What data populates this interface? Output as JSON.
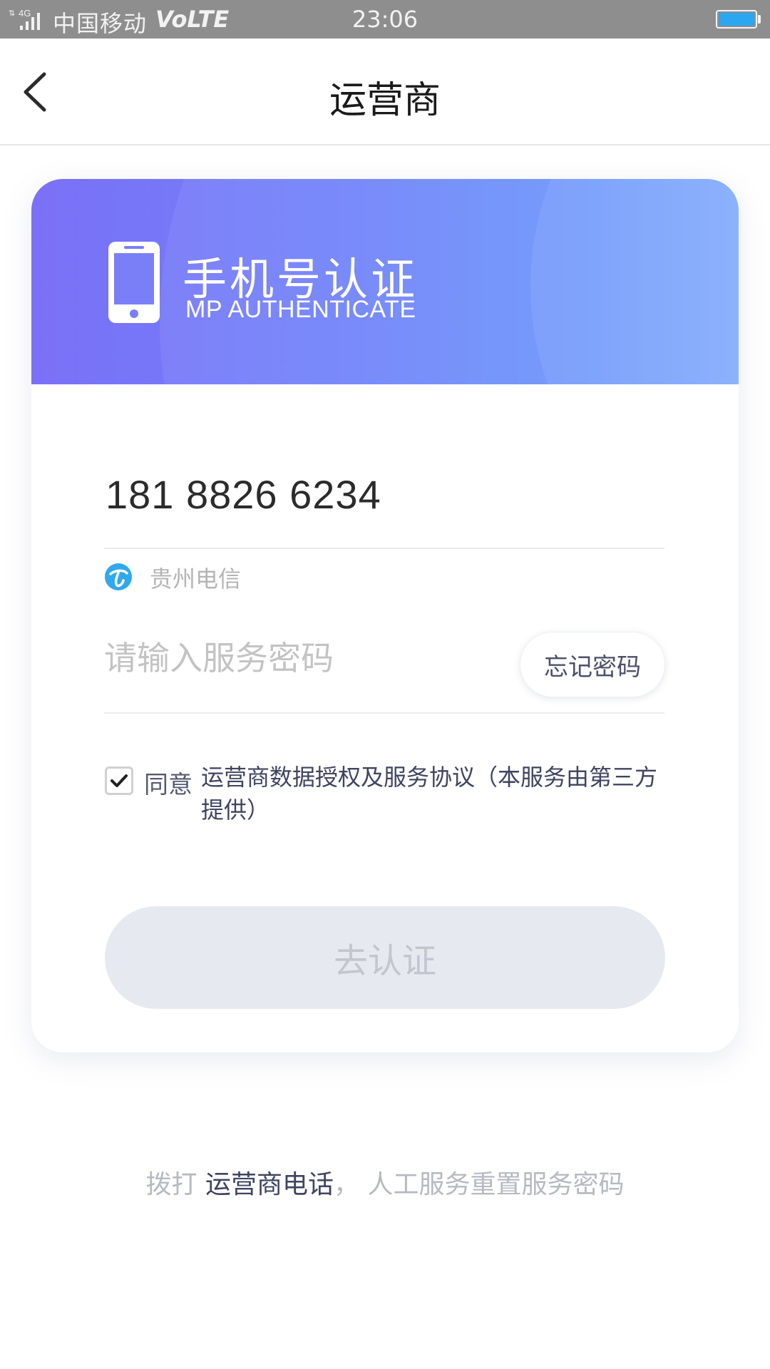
{
  "status_bar": {
    "network": "4G",
    "carrier": "中国移动",
    "volte": "VoLTE",
    "time": "23:06",
    "battery_level": 1.0,
    "battery_color": "#2aa7f0"
  },
  "header": {
    "back_icon": "chevron-left-icon",
    "title": "运营商"
  },
  "banner": {
    "icon": "mobile-phone-icon",
    "title": "手机号认证",
    "subtitle": "MP AUTHENTICATE",
    "gradient_start": "#7b70f7",
    "gradient_end": "#7aa6fb"
  },
  "form": {
    "phone_number": "181 8826 6234",
    "operator_icon": "china-telecom-icon",
    "operator": "贵州电信",
    "password_placeholder": "请输入服务密码",
    "password_value": "",
    "forgot_label": "忘记密码",
    "agree_checked": true,
    "agree_prefix": "同意",
    "agree_link": "运营商数据授权及服务协议（本服务由第三方提供）",
    "submit_label": "去认证",
    "submit_enabled": false
  },
  "footer": {
    "prefix": "拨打 ",
    "link": "运营商电话",
    "suffix": "， 人工服务重置服务密码"
  }
}
